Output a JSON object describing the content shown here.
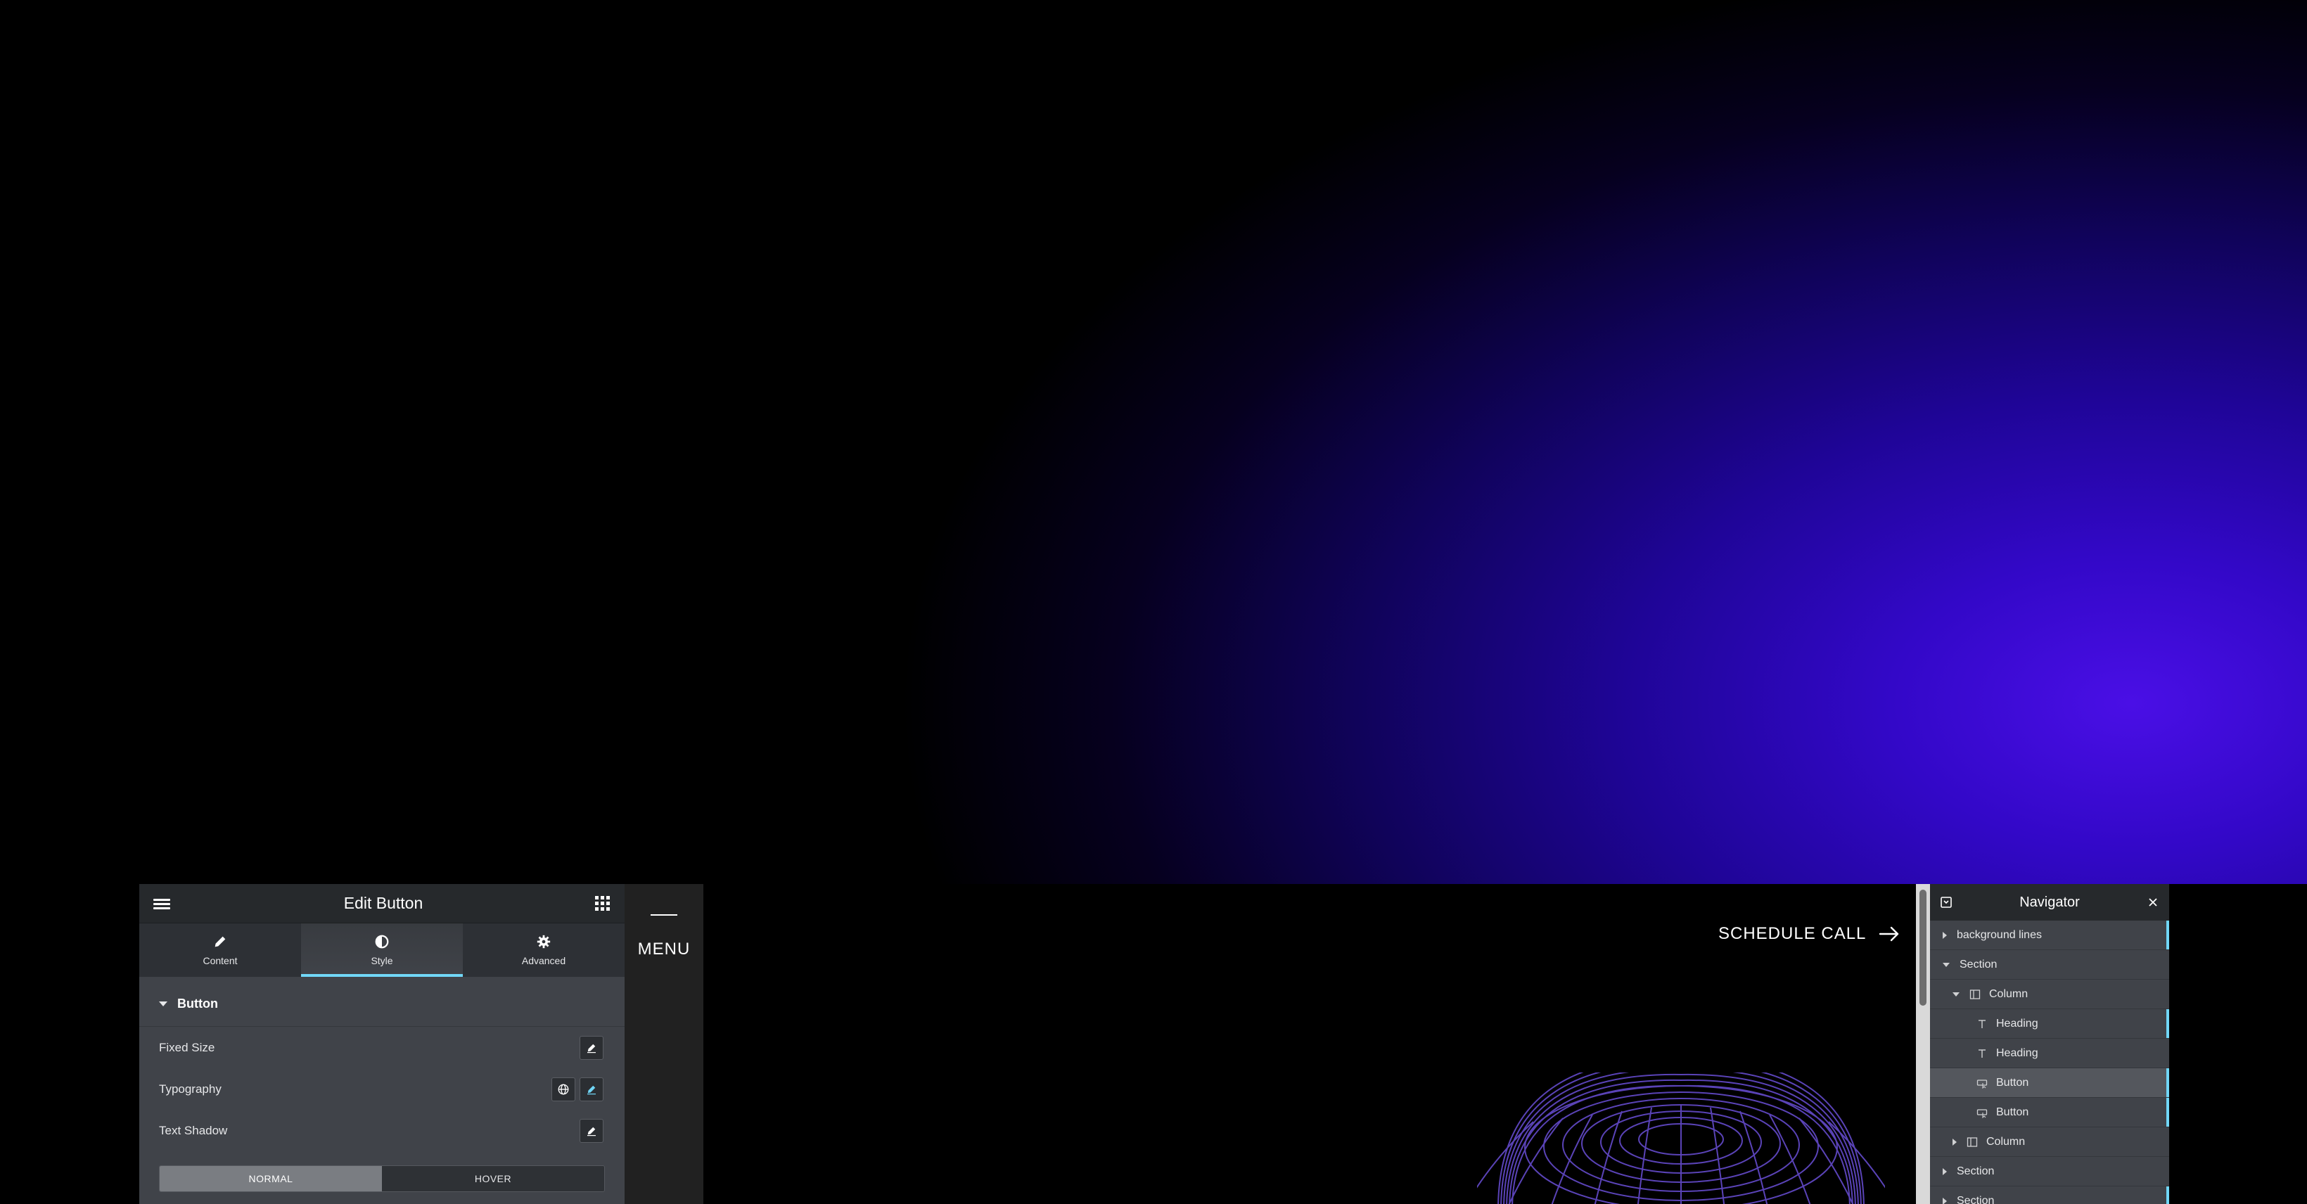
{
  "panel": {
    "title": "Edit Button",
    "tabs": [
      {
        "label": "Content",
        "icon": "pencil-icon"
      },
      {
        "label": "Style",
        "icon": "half-circle-icon",
        "active": true
      },
      {
        "label": "Advanced",
        "icon": "gear-icon"
      }
    ],
    "section_title": "Button",
    "controls": [
      {
        "label": "Fixed Size"
      },
      {
        "label": "Typography"
      },
      {
        "label": "Text Shadow"
      }
    ],
    "state_toggle": {
      "normal": "NORMAL",
      "hover": "HOVER",
      "selected": "NORMAL"
    }
  },
  "page": {
    "menu_label": "MENU",
    "cta_label": "SCHEDULE CALL"
  },
  "navigator": {
    "title": "Navigator",
    "items": [
      {
        "label": "background lines",
        "type": "section",
        "expanded": false
      },
      {
        "label": "Section",
        "type": "section",
        "expanded": true
      },
      {
        "label": "Column",
        "type": "column",
        "expanded": true
      },
      {
        "label": "Heading",
        "type": "widget"
      },
      {
        "label": "Heading",
        "type": "widget"
      },
      {
        "label": "Button",
        "type": "widget",
        "selected": true
      },
      {
        "label": "Button",
        "type": "widget"
      },
      {
        "label": "Column",
        "type": "column",
        "expanded": false
      },
      {
        "label": "Section",
        "type": "section",
        "expanded": false
      },
      {
        "label": "Section",
        "type": "section",
        "expanded": false
      }
    ]
  },
  "colors": {
    "accent": "#71d7f7",
    "panel_bg": "#404349",
    "header_bg": "#26292c",
    "glow": "#4a0fe6"
  }
}
